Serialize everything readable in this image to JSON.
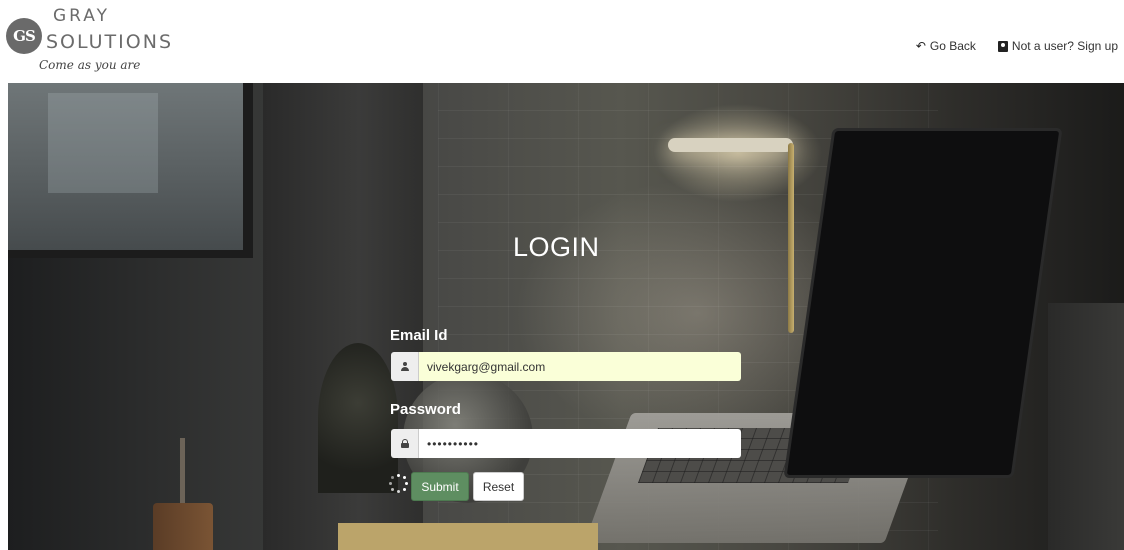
{
  "brand": {
    "logo_mark": "GS",
    "name_line1": "GRAY",
    "name_line2": "SOLUTIONS",
    "tagline": "Come as you are"
  },
  "nav": {
    "go_back": "Go Back",
    "signup": "Not a user? Sign up"
  },
  "login": {
    "title": "LOGIN",
    "email_label": "Email Id",
    "email_value": "vivekgarg@gmail.com",
    "password_label": "Password",
    "password_value": "••••••••••",
    "submit_label": "Submit",
    "reset_label": "Reset"
  },
  "colors": {
    "submit_bg": "#5e8e61",
    "autofill_bg": "#faffd8"
  },
  "icons": {
    "go_back": "reply-arrow-icon",
    "signup": "user-card-icon",
    "email_addon": "user-icon",
    "password_addon": "lock-icon",
    "spinner": "loading-spinner-icon"
  }
}
